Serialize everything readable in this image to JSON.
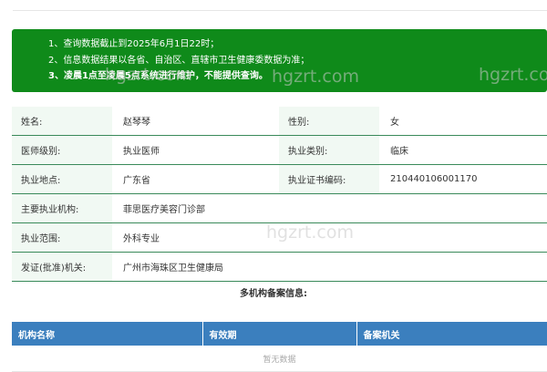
{
  "notice": {
    "lines": [
      "1、查询数据截止到2025年6月1日22时；",
      "2、信息数据结果以各省、自治区、直辖市卫生健康委数据为准；",
      "3、凌晨1点至凌晨5点系统进行维护，不能提供查询。"
    ],
    "background_color": "#0f8a1a"
  },
  "watermarks": [
    "hgzrt.com",
    "hgzrt.com",
    "hgzrt.com",
    "hgzrt.com"
  ],
  "doctor_info": {
    "rows": [
      {
        "label1": "姓名:",
        "value1": "赵琴琴",
        "label2": "性别:",
        "value2": "女"
      },
      {
        "label1": "医师级别:",
        "value1": "执业医师",
        "label2": "执业类别:",
        "value2": "临床"
      },
      {
        "label1": "执业地点:",
        "value1": "广东省",
        "label2": "执业证书编码:",
        "value2": "210440106001170"
      }
    ],
    "wide_rows": [
      {
        "label": "主要执业机构:",
        "value": "菲思医疗美容门诊部"
      },
      {
        "label": "执业范围:",
        "value": "外科专业"
      },
      {
        "label": "发证(批准)机关:",
        "value": "广州市海珠区卫生健康局"
      }
    ],
    "label_background": "#f1f9f3"
  },
  "multi_institution": {
    "title": "多机构备案信息:",
    "columns": [
      "机构名称",
      "有效期",
      "备案机关"
    ],
    "empty_text": "暂无数据",
    "header_color": "#3b7fbe"
  }
}
